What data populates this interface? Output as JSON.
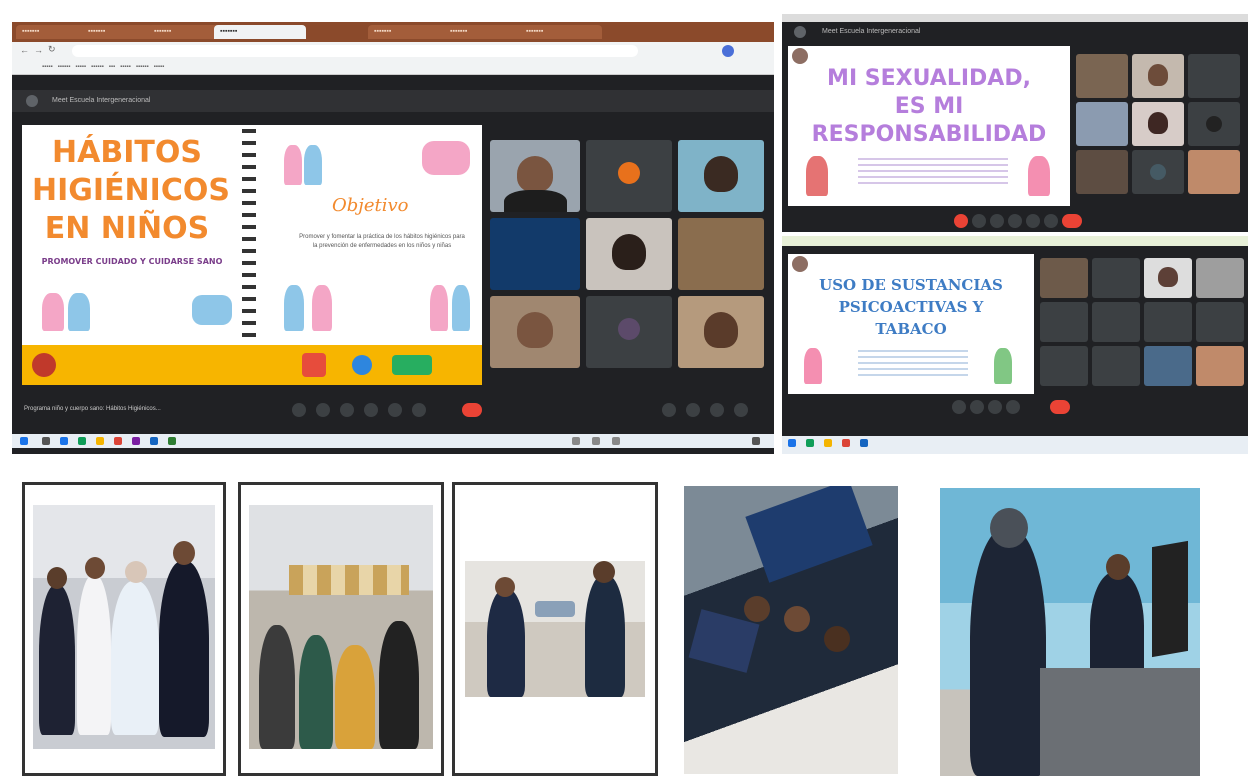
{
  "left_window": {
    "meeting_header": "Meet Escuela Intergeneracional",
    "slide1": {
      "title_line1": "HÁBITOS",
      "title_line2": "HIGIÉNICOS",
      "title_line3": "EN NIÑOS",
      "subtitle": "PROMOVER CUIDADO Y CUIDARSE SANO",
      "objetivo_label": "Objetivo",
      "objetivo_text": "Promover y fomentar la práctica de los hábitos higiénicos para la prevención de enfermedades en los niños y niñas"
    },
    "bottom_bar_text": "Programa niño y cuerpo sano: Hábitos Higiénicos..."
  },
  "right_top_window": {
    "meeting_header": "Meet Escuela Intergeneracional",
    "slide_title_line1": "MI SEXUALIDAD,",
    "slide_title_line2": "ES MI",
    "slide_title_line3": "RESPONSABILIDAD"
  },
  "right_bottom_window": {
    "slide_title_line1": "USO DE SUSTANCIAS",
    "slide_title_line2": "PSICOACTIVAS Y",
    "slide_title_line3": "TABACO"
  },
  "colors": {
    "meet_dark": "#202124",
    "tab_brown": "#8b4a2b",
    "slide1_orange": "#f28a2e",
    "slide2_purple": "#b57edc",
    "slide3_blue": "#3e7cc4",
    "end_call_red": "#ea4335"
  },
  "icons": [
    "mic-icon",
    "camera-icon",
    "captions-icon",
    "raise-hand-icon",
    "present-icon",
    "more-icon",
    "end-call-icon",
    "info-icon",
    "people-icon",
    "chat-icon",
    "activities-icon"
  ]
}
